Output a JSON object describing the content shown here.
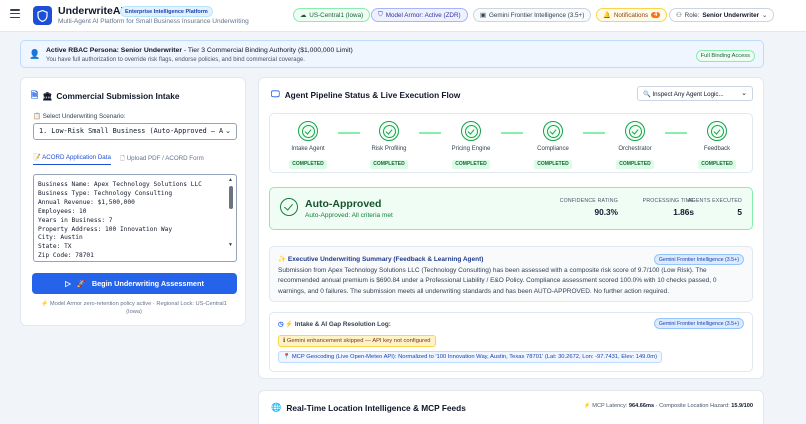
{
  "header": {
    "app_title": "UnderwriteAI",
    "platform_badge": "Enterprise Intelligence Platform",
    "subtitle": "Multi-Agent AI Platform for Small Business Insurance Underwriting",
    "region": "US-Central1 (Iowa)",
    "model_armor": "Model Armor: Active (ZDR)",
    "model": "Gemini Frontier Intelligence (3.5+)",
    "notifications_label": "Notifications",
    "notifications_count": "4",
    "role_label": "Role:",
    "role_value": "Senior Underwriter"
  },
  "banner": {
    "title_bold": "Active RBAC Persona: Senior Underwriter",
    "title_rest": " - Tier 3 Commercial Binding Authority ($1,000,000 Limit)",
    "subtitle": "You have full authorization to override risk flags, endorse policies, and bind commercial coverage.",
    "badge": "Full Binding Access"
  },
  "intake": {
    "title": "Commercial Submission Intake",
    "scenario_label": "Select Underwriting Scenario:",
    "scenario_value": "1. Low-Risk Small Business (Auto-Approved – A",
    "tab_acord": "ACORD Application Data",
    "tab_upload": "Upload PDF / ACORD Form",
    "form_lines": [
      "Business Name: Apex Technology Solutions LLC",
      "Business Type: Technology Consulting",
      "Annual Revenue: $1,500,000",
      "Employees: 10",
      "Years in Business: 7",
      "Property Address: 100 Innovation Way",
      "City: Austin",
      "State: TX",
      "Zip Code: 78701"
    ],
    "begin_button": "Begin Underwriting Assessment",
    "footnote": "Model Armor zero-retention policy active · Regional Lock: US-Central1 (Iowa)"
  },
  "pipeline": {
    "title": "Agent Pipeline Status & Live Execution Flow",
    "inspect_label": "Inspect Any Agent Logic...",
    "steps": [
      {
        "name": "Intake Agent",
        "status": "COMPLETED"
      },
      {
        "name": "Risk Profiling",
        "status": "COMPLETED"
      },
      {
        "name": "Pricing Engine",
        "status": "COMPLETED"
      },
      {
        "name": "Compliance",
        "status": "COMPLETED"
      },
      {
        "name": "Orchestrator",
        "status": "COMPLETED"
      },
      {
        "name": "Feedback",
        "status": "COMPLETED"
      }
    ]
  },
  "decision": {
    "title": "Auto-Approved",
    "subtitle": "Auto-Approved: All criteria met",
    "confidence_label": "CONFIDENCE RATING",
    "confidence_value": "90.3%",
    "time_label": "PROCESSING TIME",
    "time_value": "1.86s",
    "agents_label": "AGENTS EXECUTED",
    "agents_value": "5"
  },
  "summary": {
    "title": "Executive Underwriting Summary (Feedback & Learning Agent)",
    "badge": "Gemini Frontier Intelligence (3.5+)",
    "body": "Submission from Apex Technology Solutions LLC (Technology Consulting) has been assessed with a composite risk score of 9.7/100 (Low Risk). The recommended annual premium is $690.84 under a Professional Liability / E&O Policy. Compliance assessment scored 100.0% with 10 checks passed, 0 warnings, and 0 failures. The submission meets all underwriting standards and has been AUTO-APPROVED. No further action required."
  },
  "log": {
    "title": "Intake & AI Gap Resolution Log:",
    "badge": "Gemini Frontier Intelligence (3.5+)",
    "warning": "ℹ Gemini enhancement skipped — API key not configured",
    "mcp": "MCP Geocoding (Live Open-Meteo API): Normalized to '100 Innovation Way, Austin, Texas 78701' (Lat: 30.2672, Lon: -97.7431, Elev: 149.0m)"
  },
  "location": {
    "title": "Real-Time Location Intelligence & MCP Feeds",
    "latency_label": "MCP Latency:",
    "latency_value": "964.66ms",
    "hazard_label": "· Composite Location Hazard:",
    "hazard_value": "15.9/100"
  },
  "colors": {
    "accent": "#2563eb",
    "success": "#16a34a",
    "warning": "#f97316"
  },
  "icons": [
    "menu-icon",
    "shield-logo-icon",
    "chevron-down-icon",
    "check-circle-icon",
    "globe-icon",
    "bell-icon",
    "user-icon"
  ]
}
